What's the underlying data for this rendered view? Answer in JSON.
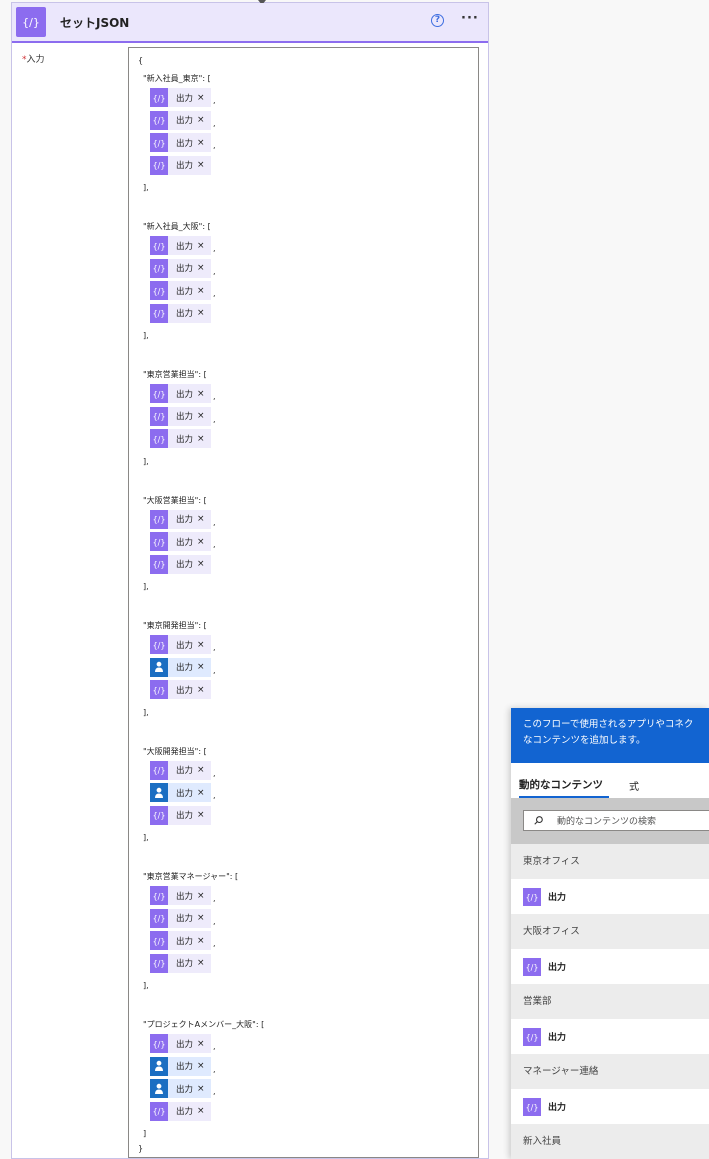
{
  "action": {
    "title": "セットJSON",
    "help_glyph": "?",
    "more_glyph": "···",
    "input_label": "入力",
    "required_mark": "*",
    "icon": "expression-curly-braces-icon"
  },
  "json_text": {
    "open_brace": "{",
    "close_brace": "}",
    "close_bracket_comma": "],",
    "close_bracket": "]",
    "comma": ",",
    "token_label": "出力",
    "token_remove": "×",
    "keys": [
      "\"新入社員_東京\": [",
      "\"新入社員_大阪\": [",
      "\"東京営業担当\": [",
      "\"大阪営業担当\": [",
      "\"東京開発担当\": [",
      "\"大阪開発担当\": [",
      "\"東京営業マネージャー\": [",
      "\"プロジェクトAメンバー_大阪\": ["
    ]
  },
  "dynamic_panel": {
    "banner_line1": "このフローで使用されるアプリやコネク",
    "banner_line2": "なコンテンツを追加します。",
    "tab_dynamic": "動的なコンテンツ",
    "tab_expression": "式",
    "search_placeholder": "動的なコンテンツの検索",
    "sections": [
      {
        "title": "東京オフィス",
        "item": "出力"
      },
      {
        "title": "大阪オフィス",
        "item": "出力"
      },
      {
        "title": "営業部",
        "item": "出力"
      },
      {
        "title": "マネージャー連絡",
        "item": "出力"
      },
      {
        "title": "新入社員"
      }
    ]
  },
  "colors": {
    "accent_purple": "#8c6cef",
    "user_blue": "#1b6ec2",
    "banner_blue": "#1264d1"
  }
}
